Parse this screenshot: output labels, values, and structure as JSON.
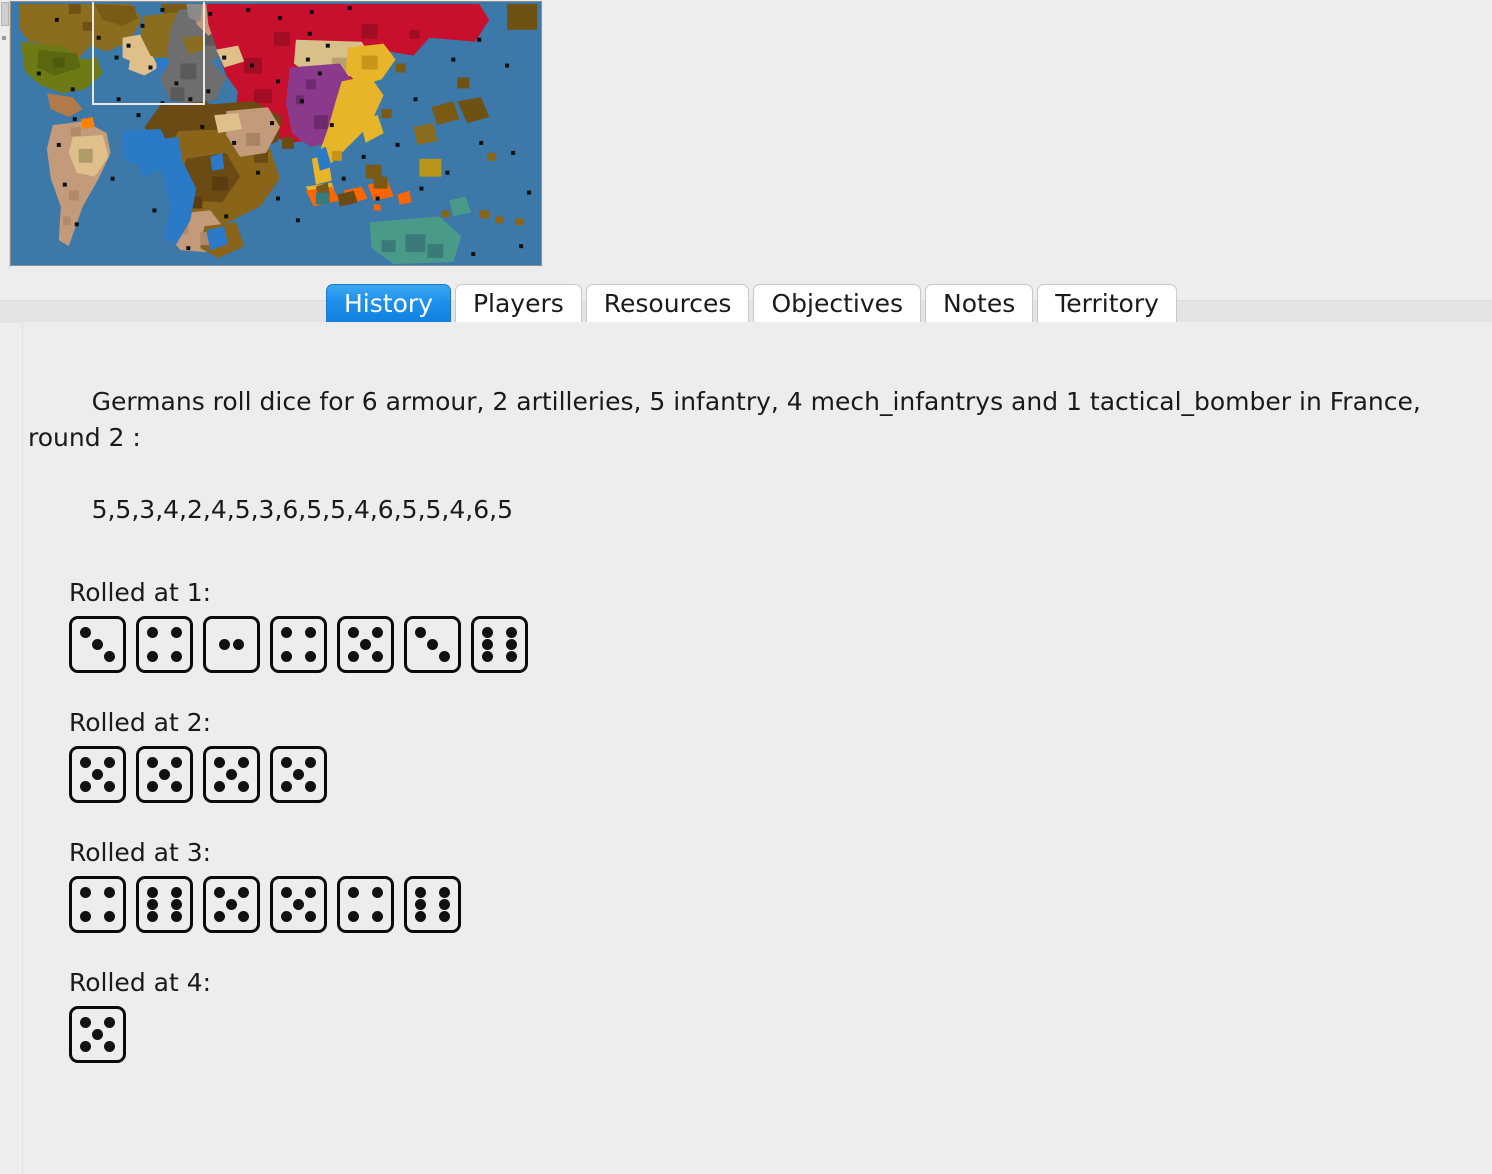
{
  "window": {
    "app": "TripleA",
    "background_color": "#ededed"
  },
  "minimap": {
    "name": "world-minimap",
    "viewport_rect_color": "#e8e8e8",
    "ocean_color": "#3c78a8",
    "player_colors": {
      "russians": "#c8102e",
      "germans": "#6e6e6e",
      "japanese": "#e8b42a",
      "chinese": "#8b3a8b",
      "americans": "#8a6d1f",
      "british": "#1878cf",
      "anzac": "#4a9a8a",
      "french": "#d4a574",
      "italians": "#7a5a1a",
      "neutral": "#b07a4a",
      "dutch": "#ff7f00"
    }
  },
  "tabs": {
    "selected": "History",
    "items": [
      {
        "label": "History",
        "name": "tab-history"
      },
      {
        "label": "Players",
        "name": "tab-players"
      },
      {
        "label": "Resources",
        "name": "tab-resources"
      },
      {
        "label": "Objectives",
        "name": "tab-objectives"
      },
      {
        "label": "Notes",
        "name": "tab-notes"
      },
      {
        "label": "Territory",
        "name": "tab-territory"
      }
    ]
  },
  "history": {
    "message_line1": "Germans roll dice for 6 armour, 2 artilleries, 5 infantry, 4 mech_infantrys and 1 tactical_bomber in France, round 2 :",
    "message_line2": "5,5,3,4,2,4,5,3,6,5,5,4,6,5,5,4,6,5",
    "full_message": "Germans roll dice for 6 armour, 2 artilleries, 5 infantry, 4 mech_infantrys and 1 tactical_bomber in France, round 2 : 5,5,3,4,2,4,5,3,6,5,5,4,6,5,5,4,6,5",
    "player": "Germans",
    "territory": "France",
    "round": 2,
    "units": [
      {
        "count": 6,
        "type": "armour"
      },
      {
        "count": 2,
        "type": "artilleries"
      },
      {
        "count": 5,
        "type": "infantry"
      },
      {
        "count": 4,
        "type": "mech_infantrys"
      },
      {
        "count": 1,
        "type": "tactical_bomber"
      }
    ],
    "all_rolls": [
      5,
      5,
      3,
      4,
      2,
      4,
      5,
      3,
      6,
      5,
      5,
      4,
      6,
      5,
      5,
      4,
      6,
      5
    ],
    "roll_groups": [
      {
        "label": "Rolled at 1:",
        "values": [
          3,
          4,
          2,
          4,
          5,
          3,
          6
        ]
      },
      {
        "label": "Rolled at 2:",
        "values": [
          5,
          5,
          5,
          5
        ]
      },
      {
        "label": "Rolled at 3:",
        "values": [
          4,
          6,
          5,
          5,
          4,
          6
        ]
      },
      {
        "label": "Rolled at 4:",
        "values": [
          5
        ]
      }
    ]
  }
}
